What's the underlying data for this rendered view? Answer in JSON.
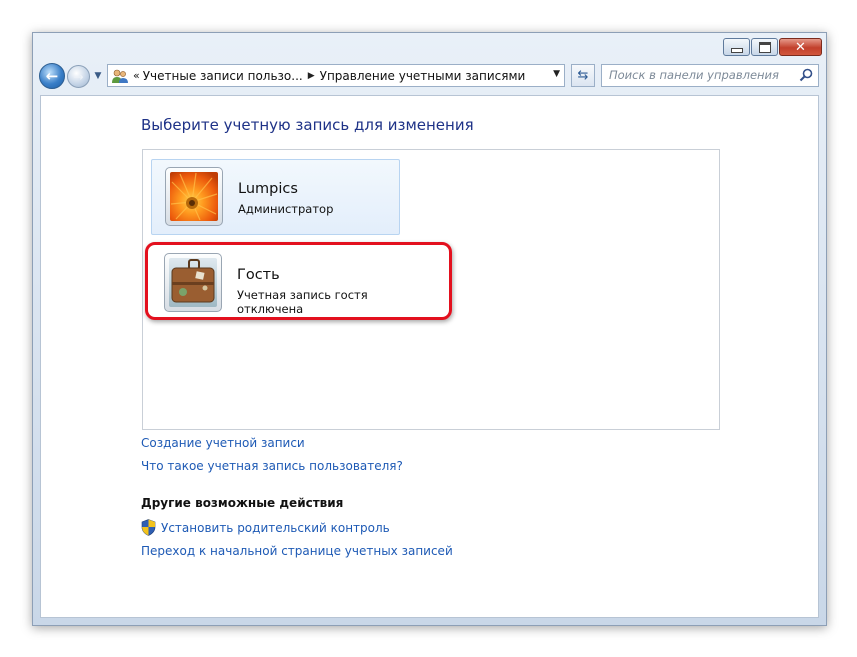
{
  "address_bar": {
    "chevron": "«",
    "crumb1": "Учетные записи пользо...",
    "crumb2": "Управление учетными записями"
  },
  "search": {
    "placeholder": "Поиск в панели управления"
  },
  "heading": "Выберите учетную запись для изменения",
  "accounts": [
    {
      "name": "Lumpics",
      "role": "Администратор",
      "picture": "orange-flower"
    },
    {
      "name": "Гость",
      "role": "Учетная запись гостя отключена",
      "picture": "suitcase"
    }
  ],
  "links": {
    "create_account": "Создание учетной записи",
    "what_is_account": "Что такое учетная запись пользователя?"
  },
  "other_actions": {
    "title": "Другие возможные действия",
    "parental_control": "Установить родительский контроль",
    "go_home": "Переход к начальной странице учетных записей"
  },
  "colors": {
    "link": "#1e5ab5",
    "heading": "#1e3287",
    "highlight": "#e3101e",
    "selected_tile": "#e3eefb"
  },
  "icons": {
    "back": "back-arrow-icon",
    "forward": "forward-arrow-icon",
    "refresh": "refresh-icon",
    "search": "search-icon",
    "users": "users-icon",
    "shield": "uac-shield-icon"
  }
}
